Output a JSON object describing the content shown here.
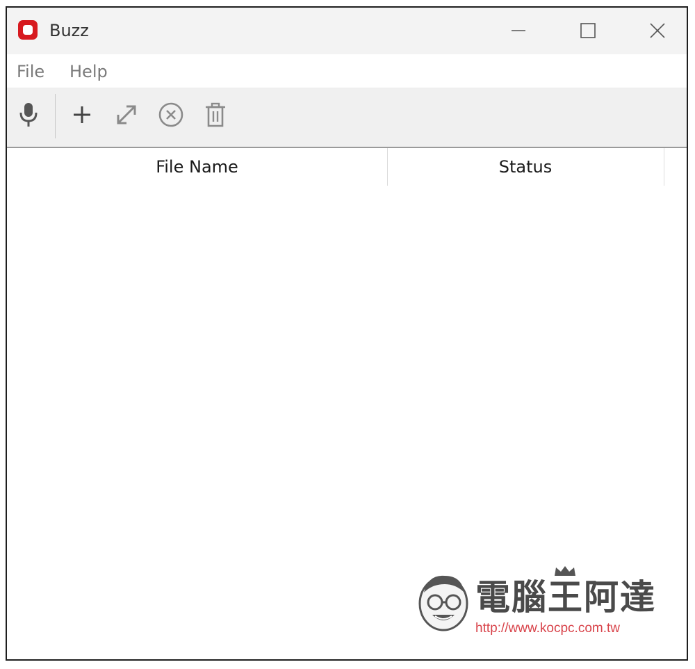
{
  "window": {
    "title": "Buzz",
    "brand_color": "#d71a1f"
  },
  "menu": {
    "items": [
      "File",
      "Help"
    ]
  },
  "toolbar": {
    "tools": [
      {
        "icon": "microphone-icon",
        "label": "Record"
      },
      {
        "icon": "plus-icon",
        "label": "Add"
      },
      {
        "icon": "expand-icon",
        "label": "Open"
      },
      {
        "icon": "cancel-circle-icon",
        "label": "Cancel"
      },
      {
        "icon": "trash-icon",
        "label": "Delete"
      }
    ]
  },
  "table": {
    "columns": [
      "File Name",
      "Status"
    ],
    "rows": []
  },
  "watermark": {
    "title": "電腦王阿達",
    "url": "http://www.kocpc.com.tw"
  }
}
